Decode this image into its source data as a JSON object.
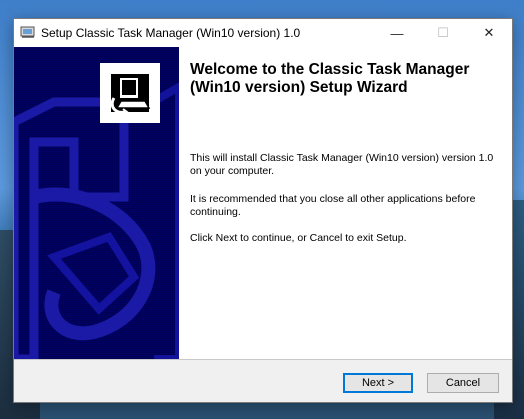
{
  "window": {
    "title": "Setup Classic Task Manager (Win10 version) 1.0",
    "controls": {
      "minimize": "—",
      "maximize": "☐",
      "close": "✕"
    }
  },
  "wizard": {
    "heading": "Welcome to the Classic Task Manager (Win10 version) Setup Wizard",
    "paragraph_1": "This will install Classic Task Manager (Win10 version) version 1.0 on your computer.",
    "paragraph_2": "It is recommended that you close all other applications before continuing.",
    "paragraph_3": "Click Next to continue, or Cancel to exit Setup."
  },
  "buttons": {
    "next_label": "Next >",
    "cancel_label": "Cancel"
  },
  "colors": {
    "side_panel": "#00007a",
    "accent": "#0078d7"
  },
  "icons": {
    "title_icon": "setup-installer-icon",
    "logo": "computer-installer-icon"
  }
}
